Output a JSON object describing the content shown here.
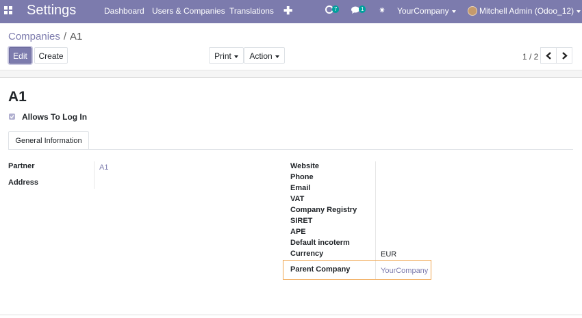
{
  "navbar": {
    "app_title": "Settings",
    "menu": [
      "Dashboard",
      "Users & Companies",
      "Translations"
    ],
    "activity_count": "7",
    "message_count": "1",
    "company": "YourCompany",
    "user": "Mitchell Admin (Odoo_12)",
    "accent_color": "#7c7bad"
  },
  "breadcrumb": {
    "parent": "Companies",
    "separator": "/",
    "current": "A1"
  },
  "toolbar": {
    "edit_label": "Edit",
    "create_label": "Create",
    "print_label": "Print",
    "action_label": "Action",
    "pager": "1 / 2"
  },
  "record": {
    "name": "A1",
    "allows_login_label": "Allows To Log In",
    "allows_login": true
  },
  "tabs": [
    "General Information"
  ],
  "left_fields": {
    "partner_label": "Partner",
    "partner_value": "A1",
    "address_label": "Address"
  },
  "right_fields": {
    "website": "Website",
    "phone": "Phone",
    "email": "Email",
    "vat": "VAT",
    "registry": "Company Registry",
    "siret": "SIRET",
    "ape": "APE",
    "incoterm": "Default incoterm",
    "currency": "Currency",
    "currency_value": "EUR",
    "parent_company": "Parent Company",
    "parent_company_value": "YourCompany"
  }
}
